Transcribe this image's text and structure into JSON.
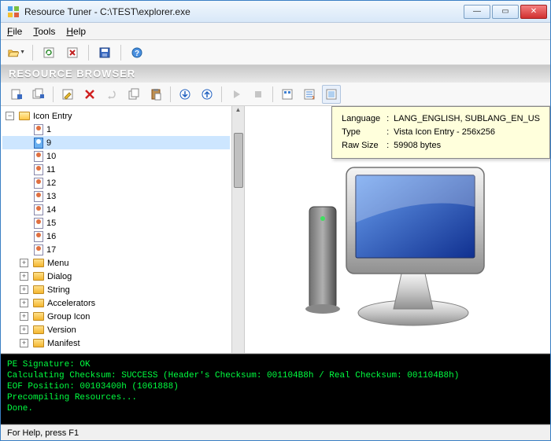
{
  "window": {
    "title": "Resource Tuner - C:\\TEST\\explorer.exe"
  },
  "menu": {
    "file": "File",
    "tools": "Tools",
    "help": "Help"
  },
  "section": {
    "title": "RESOURCE BROWSER"
  },
  "tree": {
    "root": "Icon Entry",
    "icons": [
      "1",
      "9",
      "10",
      "11",
      "12",
      "13",
      "14",
      "15",
      "16",
      "17"
    ],
    "selected_index": 1,
    "folders": [
      "Menu",
      "Dialog",
      "String",
      "Accelerators",
      "Group Icon",
      "Version",
      "Manifest"
    ]
  },
  "tooltip": {
    "language_label": "Language",
    "language_value": "LANG_ENGLISH, SUBLANG_EN_US",
    "type_label": "Type",
    "type_value": "Vista Icon Entry - 256x256",
    "rawsize_label": "Raw Size",
    "rawsize_value": "59908 bytes"
  },
  "console": {
    "line1": "PE Signature: OK",
    "line2": "Calculating Checksum: SUCCESS (Header's Checksum: 001104B8h / Real Checksum: 001104B8h)",
    "line3": "EOF Position: 00103400h  (1061888)",
    "line4": "Precompiling Resources...",
    "line5": "Done."
  },
  "status": {
    "text": "For Help, press F1"
  }
}
